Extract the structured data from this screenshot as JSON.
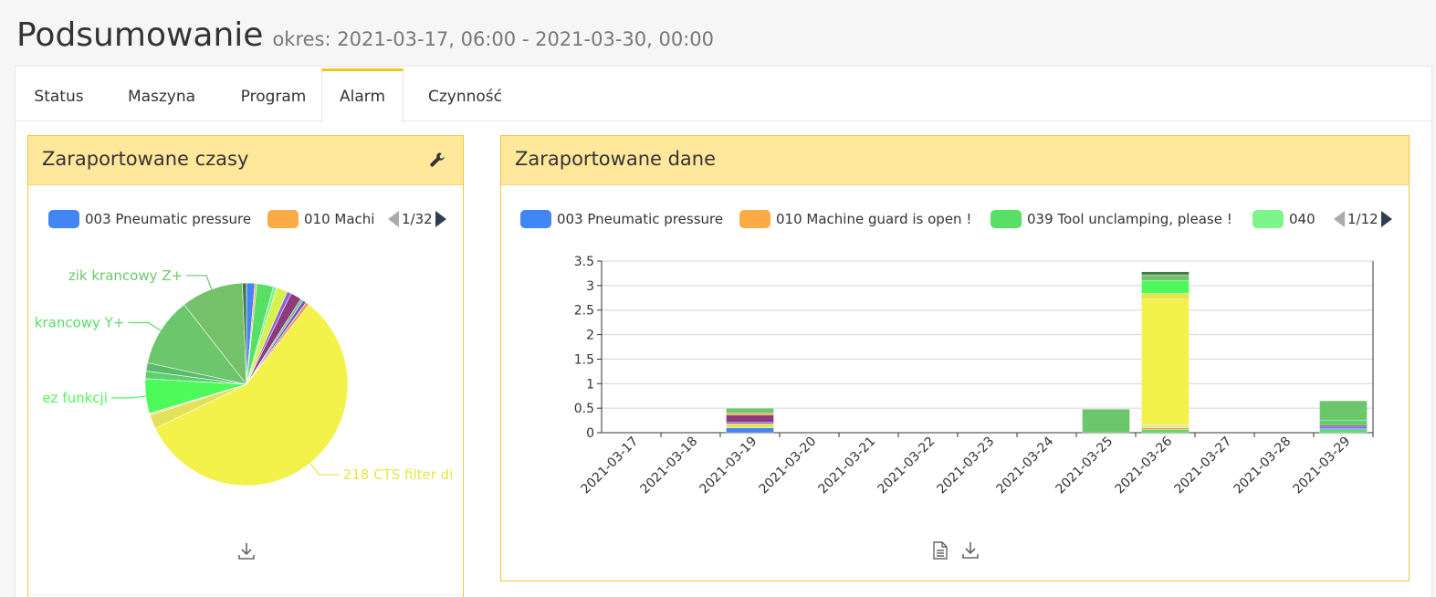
{
  "header": {
    "title": "Podsumowanie",
    "subtitle": "okres: 2021-03-17, 06:00 - 2021-03-30, 00:00"
  },
  "tabs": [
    {
      "label": "Status",
      "active": false
    },
    {
      "label": "Maszyna",
      "active": false
    },
    {
      "label": "Program",
      "active": false
    },
    {
      "label": "Alarm",
      "active": true
    },
    {
      "label": "Czynność",
      "active": false
    }
  ],
  "left_card": {
    "title": "Zaraportowane czasy",
    "tool_icon": "wrench-icon",
    "download_icon": "download-icon",
    "legend": [
      {
        "label": "003 Pneumatic pressure",
        "color": "#4285f4"
      },
      {
        "label": "010 Machi",
        "color": "#fbac47"
      }
    ],
    "pager": "1/32"
  },
  "right_card": {
    "title": "Zaraportowane dane",
    "report_icon": "document-icon",
    "download_icon": "download-icon",
    "legend": [
      {
        "label": "003 Pneumatic pressure",
        "color": "#4285f4"
      },
      {
        "label": "010 Machine guard is open !",
        "color": "#fbac47"
      },
      {
        "label": "039 Tool unclamping, please !",
        "color": "#57e065"
      },
      {
        "label": "040 `",
        "color": "#7ef58a"
      }
    ],
    "pager": "1/12"
  },
  "chart_data": [
    {
      "type": "pie",
      "labels_visible": [
        "zik krancowy Z+",
        "krancowy Y+",
        "ez funkcji",
        "218 CTS filter di"
      ],
      "slices": [
        {
          "color": "#4285f4",
          "value": 1.2
        },
        {
          "color": "#fbac47",
          "value": 0.3
        },
        {
          "color": "#57e065",
          "value": 2.4
        },
        {
          "color": "#7ef58a",
          "value": 0.5
        },
        {
          "color": "#d8f04a",
          "value": 1.6
        },
        {
          "color": "#8a63d2",
          "value": 0.6
        },
        {
          "color": "#8e3a7e",
          "value": 1.6
        },
        {
          "color": "#6ec06e",
          "value": 0.4
        },
        {
          "color": "#6b55d6",
          "value": 0.5
        },
        {
          "color": "#f39c4a",
          "value": 0.5
        },
        {
          "color": "#f2f24a",
          "value": 52.0
        },
        {
          "color": "#e3e05a",
          "value": 2.0
        },
        {
          "color": "#dde8a0",
          "value": 0.3
        },
        {
          "color": "#4cfa5c",
          "value": 5.0
        },
        {
          "color": "#5ccf6f",
          "value": 1.1
        },
        {
          "color": "#5aba6c",
          "value": 1.2
        },
        {
          "color": "#6cc76c",
          "value": 10.0
        },
        {
          "color": "#75c16a",
          "value": 9.0
        },
        {
          "color": "#3f7a4a",
          "value": 0.6
        }
      ],
      "label_map": [
        {
          "text": "zik krancowy Z+",
          "slice": 17,
          "color": "#6cc76c"
        },
        {
          "text": "krancowy Y+",
          "slice": 16,
          "color": "#57e065"
        },
        {
          "text": "ez funkcji",
          "slice": 13,
          "color": "#4cfa5c"
        },
        {
          "text": "218 CTS filter di",
          "slice": 10,
          "color": "#e6e64a"
        }
      ]
    },
    {
      "type": "bar",
      "stacked": true,
      "categories": [
        "2021-03-17",
        "2021-03-18",
        "2021-03-19",
        "2021-03-20",
        "2021-03-21",
        "2021-03-22",
        "2021-03-23",
        "2021-03-24",
        "2021-03-25",
        "2021-03-26",
        "2021-03-27",
        "2021-03-28",
        "2021-03-29"
      ],
      "ylim": [
        0,
        3.5
      ],
      "yticks": [
        "0",
        "0.5",
        "1",
        "1.5",
        "2",
        "2.5",
        "3",
        "3.5"
      ],
      "stacks": [
        [],
        [],
        [
          {
            "value": 0.1,
            "color": "#4285f4"
          },
          {
            "value": 0.08,
            "color": "#e6e64a"
          },
          {
            "value": 0.04,
            "color": "#8a63d2"
          },
          {
            "value": 0.14,
            "color": "#8e3a7e"
          },
          {
            "value": 0.04,
            "color": "#f39c4a"
          },
          {
            "value": 0.1,
            "color": "#6cc76c"
          }
        ],
        [],
        [],
        [],
        [],
        [],
        [
          {
            "value": 0.48,
            "color": "#6cc76c"
          }
        ],
        [
          {
            "value": 0.06,
            "color": "#57e065"
          },
          {
            "value": 0.04,
            "color": "#f39c4a"
          },
          {
            "value": 0.06,
            "color": "#dde8a0"
          },
          {
            "value": 2.56,
            "color": "#f2f24a"
          },
          {
            "value": 0.12,
            "color": "#e6e64a"
          },
          {
            "value": 0.26,
            "color": "#4cfa5c"
          },
          {
            "value": 0.12,
            "color": "#75c16a"
          },
          {
            "value": 0.06,
            "color": "#3f7a4a"
          }
        ],
        [],
        [],
        [
          {
            "value": 0.06,
            "color": "#57e065"
          },
          {
            "value": 0.03,
            "color": "#4285f4"
          },
          {
            "value": 0.03,
            "color": "#8a63d2"
          },
          {
            "value": 0.03,
            "color": "#8e3a7e"
          },
          {
            "value": 0.1,
            "color": "#5ccf6f"
          },
          {
            "value": 0.4,
            "color": "#6cc76c"
          }
        ]
      ]
    }
  ]
}
